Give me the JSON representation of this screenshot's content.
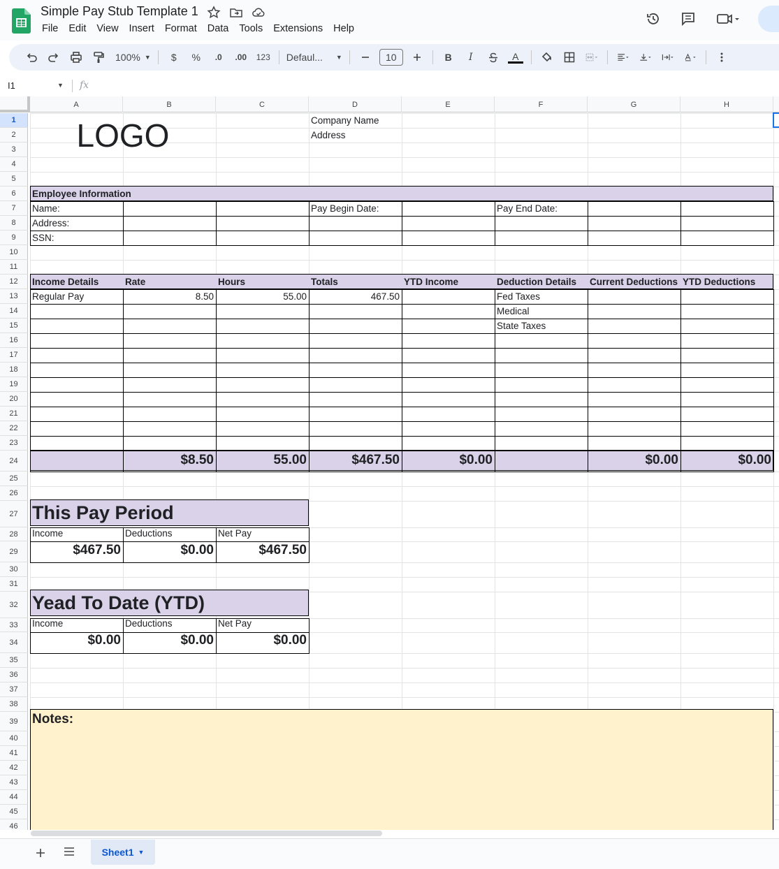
{
  "app": {
    "title": "Simple Pay Stub Template 1",
    "menu": [
      "File",
      "Edit",
      "View",
      "Insert",
      "Format",
      "Data",
      "Tools",
      "Extensions",
      "Help"
    ]
  },
  "toolbar": {
    "zoom": "100%",
    "currency": "$",
    "percent": "%",
    "dec_decrease": ".0",
    "dec_increase": ".00",
    "number_format": "123",
    "font": "Defaul...",
    "font_size": "10",
    "bold": "B",
    "italic": "I",
    "text_color": "A"
  },
  "formula_bar": {
    "cell_ref": "I1",
    "fx": "fx"
  },
  "columns": [
    "A",
    "B",
    "C",
    "D",
    "E",
    "F",
    "G",
    "H"
  ],
  "rows": [
    "1",
    "2",
    "3",
    "4",
    "5",
    "6",
    "7",
    "8",
    "9",
    "10",
    "11",
    "12",
    "13",
    "14",
    "15",
    "16",
    "17",
    "18",
    "19",
    "20",
    "21",
    "22",
    "23",
    "24",
    "25",
    "26",
    "27",
    "28",
    "29",
    "30",
    "31",
    "32",
    "33",
    "34",
    "35",
    "36",
    "37",
    "38",
    "39",
    "40",
    "41",
    "42",
    "43",
    "44",
    "45",
    "46"
  ],
  "sheet": {
    "logo": "LOGO",
    "company_name": "Company Name",
    "address": "Address",
    "employee_info": "Employee Information",
    "name_label": "Name:",
    "address_label": "Address:",
    "ssn_label": "SSN:",
    "pay_begin": "Pay Begin Date:",
    "pay_end": "Pay End Date:",
    "income_headers": [
      "Income Details",
      "Rate",
      "Hours",
      "Totals",
      "YTD Income",
      "Deduction Details",
      "Current Deductions",
      "YTD Deductions"
    ],
    "regular_pay": "Regular Pay",
    "rate": "8.50",
    "hours": "55.00",
    "total": "467.50",
    "deductions": [
      "Fed Taxes",
      "Medical",
      "State Taxes"
    ],
    "totals_row": {
      "rate": "$8.50",
      "hours": "55.00",
      "totals": "$467.50",
      "ytd_income": "$0.00",
      "current_deductions": "$0.00",
      "ytd_deductions": "$0.00"
    },
    "this_period": {
      "title": "This Pay Period",
      "labels": [
        "Income",
        "Deductions",
        "Net Pay"
      ],
      "values": [
        "$467.50",
        "$0.00",
        "$467.50"
      ]
    },
    "ytd": {
      "title": "Yead To Date (YTD)",
      "labels": [
        "Income",
        "Deductions",
        "Net Pay"
      ],
      "values": [
        "$0.00",
        "$0.00",
        "$0.00"
      ]
    },
    "notes": "Notes:"
  },
  "tabs": {
    "active": "Sheet1"
  }
}
